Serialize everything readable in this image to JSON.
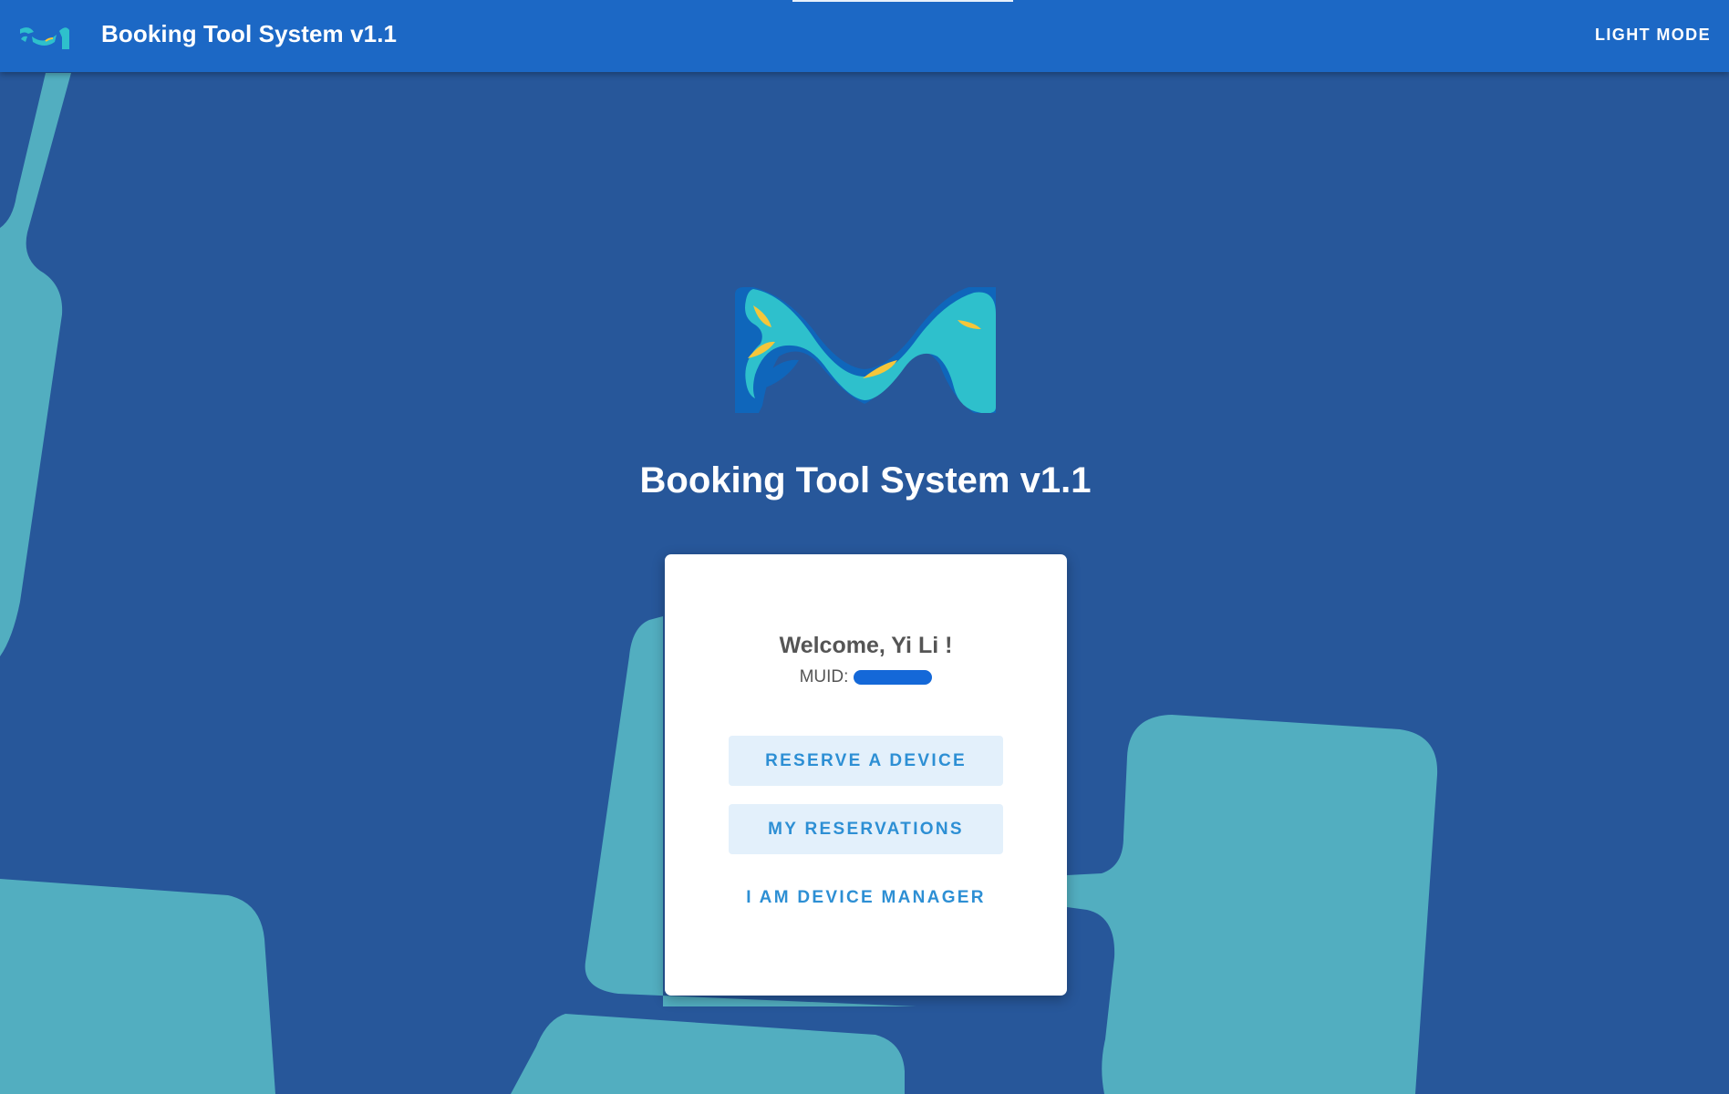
{
  "app": {
    "title": "Booking Tool System v1.1",
    "logo_icon": "m-wave-logo-icon",
    "light_mode_label": "LIGHT MODE"
  },
  "hero": {
    "logo_icon": "m-wave-logo-icon",
    "title": "Booking Tool System v1.1"
  },
  "card": {
    "welcome": "Welcome, Yi Li !",
    "muid_label": "MUID:",
    "buttons": {
      "reserve": "RESERVE A DEVICE",
      "my_reservations": "MY RESERVATIONS",
      "device_manager": "I AM DEVICE MANAGER"
    }
  },
  "colors": {
    "appbar": "#1c68c5",
    "background": "#27579a",
    "background_shapes": "#52aec0",
    "accent_text": "#2d8fd4",
    "button_fill": "#e3f0fb",
    "logo_teal": "#2ec0cc",
    "logo_blue": "#0f66bb",
    "logo_yellow": "#f5c63a"
  }
}
